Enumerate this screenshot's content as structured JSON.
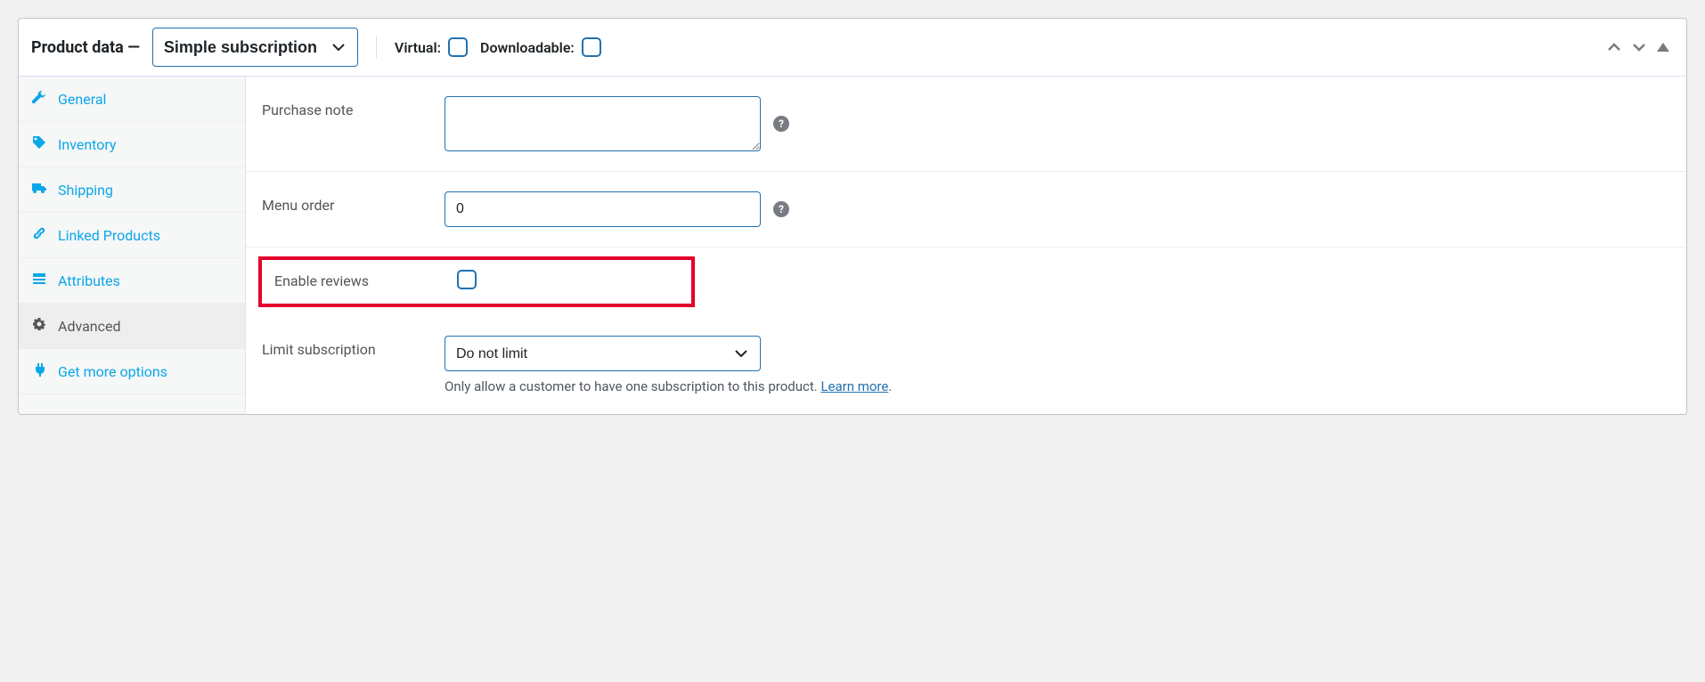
{
  "header": {
    "title": "Product data —",
    "product_type_selected": "Simple subscription",
    "virtual_label": "Virtual:",
    "downloadable_label": "Downloadable:"
  },
  "sidebar": {
    "items": [
      {
        "label": "General"
      },
      {
        "label": "Inventory"
      },
      {
        "label": "Shipping"
      },
      {
        "label": "Linked Products"
      },
      {
        "label": "Attributes"
      },
      {
        "label": "Advanced"
      },
      {
        "label": "Get more options"
      }
    ]
  },
  "fields": {
    "purchase_note_label": "Purchase note",
    "purchase_note_value": "",
    "menu_order_label": "Menu order",
    "menu_order_value": "0",
    "enable_reviews_label": "Enable reviews",
    "limit_subscription_label": "Limit subscription",
    "limit_subscription_selected": "Do not limit",
    "limit_subscription_hint_text": "Only allow a customer to have one subscription to this product. ",
    "limit_subscription_learn_more": "Learn more",
    "limit_subscription_hint_period": "."
  }
}
